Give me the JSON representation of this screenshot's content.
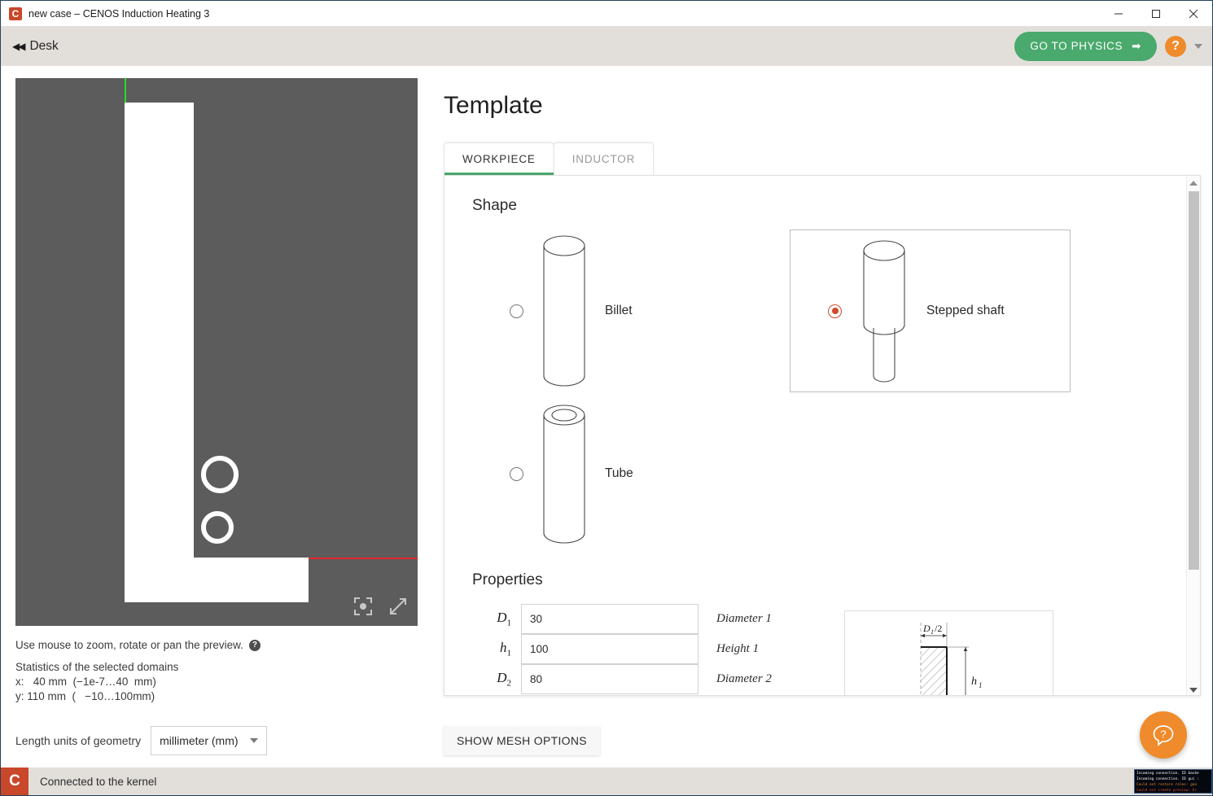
{
  "window": {
    "title": "new case – CENOS Induction Heating 3",
    "app_icon": "cenos-logo-icon",
    "minimize": "–",
    "maximize": "□",
    "close": "✕"
  },
  "toolbar": {
    "back_arrow": "◀◀",
    "desk_label": "Desk",
    "physics_button": "GO TO PHYSICS",
    "physics_arrow": "➡",
    "help_badge": "?",
    "accent_green": "#4aa96c",
    "accent_orange": "#ef8b2c"
  },
  "preview": {
    "hint": "Use mouse to zoom, rotate or pan the preview.",
    "hint_help_badge": "?",
    "stats_title": "Statistics of the selected domains",
    "stats_x": "x:   40 mm  (−1e-7…40  mm)",
    "stats_y": "y: 110 mm  (   −10…100mm)",
    "focus_icon": "focus-target-icon",
    "expand_icon": "expand-arrows-icon",
    "background_color": "#5c5c5c",
    "geometry_color": "#ffffff",
    "axis_green": "#22dd22",
    "axis_red": "#e8262c"
  },
  "units": {
    "label": "Length units of geometry",
    "selected": "millimeter (mm)",
    "options": [
      "millimeter (mm)"
    ]
  },
  "main": {
    "title": "Template",
    "tabs": [
      {
        "label": "WORKPIECE",
        "active": true
      },
      {
        "label": "INDUCTOR",
        "active": false
      }
    ],
    "shape_section": "Shape",
    "shapes": [
      {
        "label": "Billet",
        "selected": false,
        "art": "cylinder-icon"
      },
      {
        "label": "Stepped shaft",
        "selected": true,
        "art": "stepped-shaft-icon"
      },
      {
        "label": "Tube",
        "selected": false,
        "art": "tube-icon"
      }
    ],
    "properties_section": "Properties",
    "properties": [
      {
        "symbol": "D",
        "sub": "1",
        "value": "30",
        "description": "Diameter 1"
      },
      {
        "symbol": "h",
        "sub": "1",
        "value": "100",
        "description": "Height 1"
      },
      {
        "symbol": "D",
        "sub": "2",
        "value": "80",
        "description": "Diameter 2"
      }
    ],
    "figure_labels": {
      "d1_half": "D₁/2",
      "h1": "h₁"
    },
    "mesh_button": "SHOW MESH OPTIONS"
  },
  "fab": {
    "icon": "help-bubble-icon"
  },
  "status": {
    "icon": "cenos-logo-icon",
    "text": "Connected to the kernel",
    "console_lines": [
      {
        "text": "Incoming connection. ID backe",
        "color": "#ffffff"
      },
      {
        "text": "Incoming connection. ID gui :",
        "color": "#ffffff"
      },
      {
        "text": "Could not restore roles: geo",
        "color": "#e08b28"
      },
      {
        "text": "Could not create preview: Er",
        "color": "#e04b3a"
      }
    ]
  }
}
